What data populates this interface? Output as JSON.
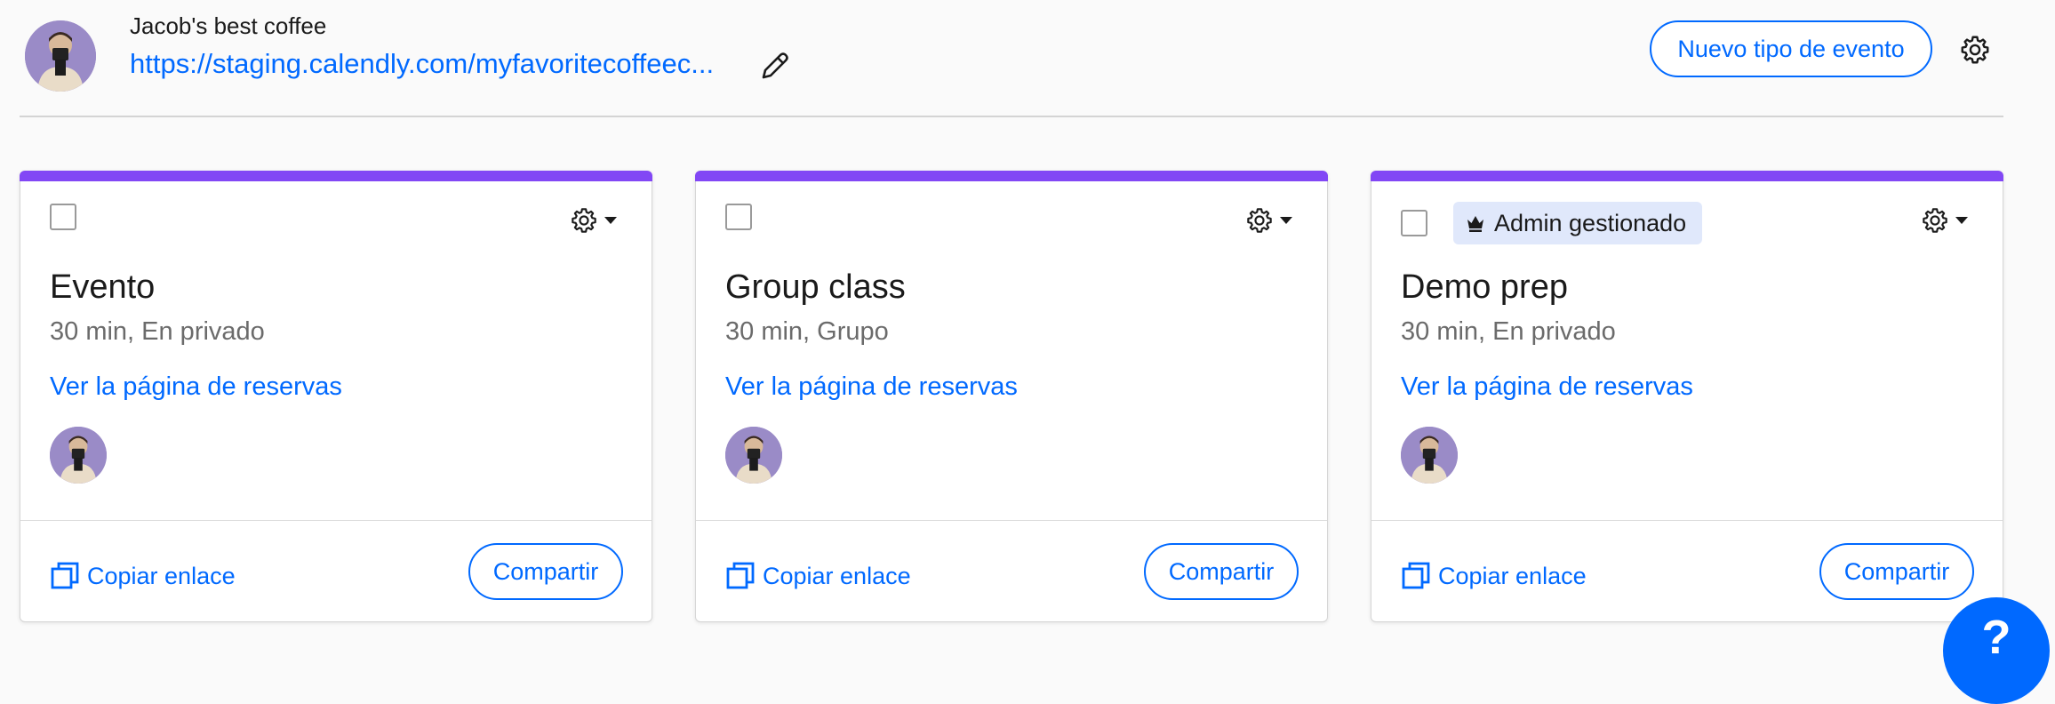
{
  "header": {
    "org_name": "Jacob's best coffee",
    "link": "https://staging.calendly.com/myfavoritecoffeec...",
    "new_event_button": "Nuevo tipo de evento"
  },
  "cards": [
    {
      "title": "Evento",
      "meta": "30 min, En privado",
      "booking_link": "Ver la página de reservas",
      "copy_link": "Copiar enlace",
      "share": "Compartir",
      "badge": ""
    },
    {
      "title": "Group class",
      "meta": "30 min, Grupo",
      "booking_link": "Ver la página de reservas",
      "copy_link": "Copiar enlace",
      "share": "Compartir",
      "badge": ""
    },
    {
      "title": "Demo prep",
      "meta": "30 min, En privado",
      "booking_link": "Ver la página de reservas",
      "copy_link": "Copiar enlace",
      "share": "Compartir",
      "badge": "Admin gestionado"
    }
  ],
  "colors": {
    "accent": "#0069ff",
    "card_top_bar": "#8247f5",
    "badge_bg": "#e0e8fb"
  },
  "icons": {
    "edit": "pencil-icon",
    "settings": "gear-icon",
    "dropdown": "caret-down-icon",
    "copy": "copy-icon",
    "admin": "crown-icon",
    "help": "help-icon"
  }
}
